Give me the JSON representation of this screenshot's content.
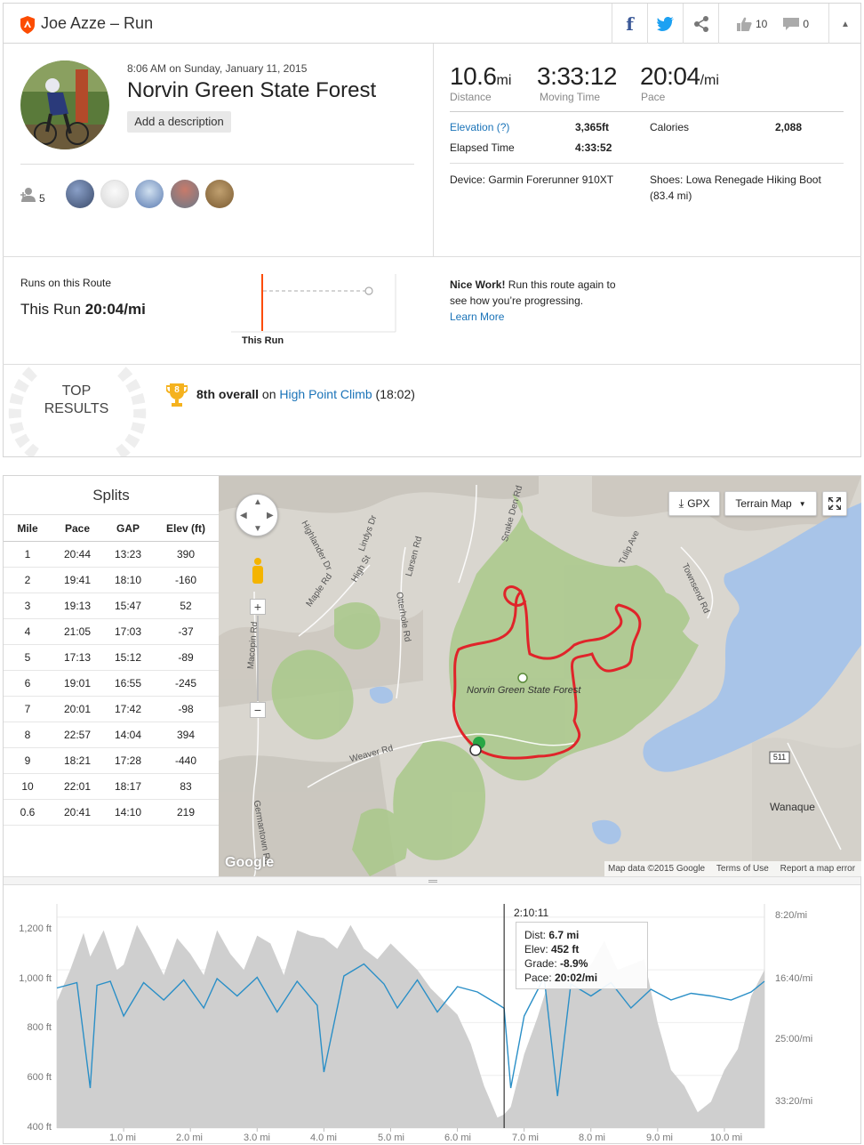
{
  "header": {
    "title": "Joe Azze – Run",
    "kudos_count": "10",
    "comment_count": "0"
  },
  "activity": {
    "datetime": "8:06 AM on Sunday, January 11, 2015",
    "name": "Norvin Green State Forest",
    "add_description": "Add a description",
    "athlete_count": "5"
  },
  "stats": {
    "distance_value": "10.6",
    "distance_unit": "mi",
    "distance_label": "Distance",
    "moving_time_value": "3:33:12",
    "moving_time_label": "Moving Time",
    "pace_value": "20:04",
    "pace_unit": "/mi",
    "pace_label": "Pace",
    "elevation_label": "Elevation (?)",
    "elevation_value": "3,365ft",
    "calories_label": "Calories",
    "calories_value": "2,088",
    "elapsed_label": "Elapsed Time",
    "elapsed_value": "4:33:52",
    "device": "Device: Garmin Forerunner 910XT",
    "shoes_line1": "Shoes: Lowa Renegade Hiking Boot",
    "shoes_line2": "(83.4 mi)"
  },
  "route": {
    "heading": "Runs on this Route",
    "this_run_prefix": "This Run",
    "this_run_value": "20:04/mi",
    "bar_label": "This Run",
    "nice_work_bold": "Nice Work!",
    "nice_work_text1": " Run this route again to",
    "nice_work_text2": "see how you’re progressing.",
    "learn_more": "Learn More"
  },
  "top_results": {
    "line1": "TOP",
    "line2": "RESULTS",
    "medal": "8",
    "rank": "8th overall",
    "on": " on ",
    "segment": "High Point Climb",
    "time": " (18:02)"
  },
  "splits": {
    "title": "Splits",
    "columns": [
      "Mile",
      "Pace",
      "GAP",
      "Elev (ft)"
    ],
    "rows": [
      [
        "1",
        "20:44",
        "13:23",
        "390"
      ],
      [
        "2",
        "19:41",
        "18:10",
        "-160"
      ],
      [
        "3",
        "19:13",
        "15:47",
        "52"
      ],
      [
        "4",
        "21:05",
        "17:03",
        "-37"
      ],
      [
        "5",
        "17:13",
        "15:12",
        "-89"
      ],
      [
        "6",
        "19:01",
        "16:55",
        "-245"
      ],
      [
        "7",
        "20:01",
        "17:42",
        "-98"
      ],
      [
        "8",
        "22:57",
        "14:04",
        "394"
      ],
      [
        "9",
        "18:21",
        "17:28",
        "-440"
      ],
      [
        "10",
        "22:01",
        "18:17",
        "83"
      ],
      [
        "0.6",
        "20:41",
        "14:10",
        "219"
      ]
    ]
  },
  "map": {
    "gpx_label": "GPX",
    "terrain_label": "Terrain Map",
    "forest_label": "Norvin Green State Forest",
    "town_label": "Wanaque",
    "route_number": "511",
    "attribution": "Map data ©2015 Google",
    "terms": "Terms of Use",
    "report": "Report a map error",
    "google": "Google",
    "road_labels": [
      "Maple Rd",
      "High St",
      "Otterhole Rd",
      "Macopin Rd",
      "Weaver Rd",
      "Germantown Rd",
      "Townsend Rd",
      "Snake Den Rd",
      "Larsen Rd",
      "Tulip Ave",
      "Highlander Dr",
      "Lindys Dr"
    ]
  },
  "chart_data": {
    "type": "area",
    "x_unit": "mi",
    "xlim": [
      0,
      10.6
    ],
    "x_ticks": [
      "1.0 mi",
      "2.0 mi",
      "3.0 mi",
      "4.0 mi",
      "5.0 mi",
      "6.0 mi",
      "7.0 mi",
      "8.0 mi",
      "9.0 mi",
      "10.0 mi"
    ],
    "y_left_ticks": [
      "1,200 ft",
      "1,000 ft",
      "800 ft",
      "600 ft",
      "400 ft"
    ],
    "y_right_ticks": [
      "8:20/mi",
      "16:40/mi",
      "25:00/mi",
      "33:20/mi"
    ],
    "ylim_elevation_ft": [
      400,
      1250
    ],
    "series": [
      {
        "name": "Elev",
        "x": [
          0,
          0.2,
          0.4,
          0.5,
          0.7,
          0.9,
          1.0,
          1.2,
          1.4,
          1.6,
          1.8,
          2.0,
          2.2,
          2.4,
          2.6,
          2.8,
          3.0,
          3.2,
          3.4,
          3.6,
          3.8,
          4.0,
          4.2,
          4.4,
          4.6,
          4.8,
          5.0,
          5.2,
          5.4,
          5.6,
          5.8,
          6.0,
          6.2,
          6.4,
          6.6,
          6.7,
          6.8,
          7.0,
          7.2,
          7.4,
          7.6,
          7.8,
          8.0,
          8.2,
          8.4,
          8.6,
          8.8,
          9.0,
          9.2,
          9.4,
          9.6,
          9.8,
          10.0,
          10.2,
          10.4,
          10.6
        ],
        "values": [
          880,
          1000,
          1140,
          1050,
          1150,
          1000,
          1020,
          1170,
          1080,
          980,
          1120,
          1060,
          980,
          1150,
          1060,
          1000,
          1130,
          1100,
          980,
          1150,
          1130,
          1120,
          1080,
          1170,
          1080,
          1040,
          1100,
          1050,
          1000,
          930,
          880,
          830,
          720,
          560,
          440,
          452,
          480,
          680,
          820,
          980,
          1050,
          980,
          1020,
          1110,
          1000,
          1020,
          1040,
          800,
          620,
          560,
          460,
          500,
          620,
          700,
          900,
          1000
        ]
      },
      {
        "name": "Pace",
        "x": [
          0,
          0.3,
          0.5,
          0.6,
          0.8,
          1.0,
          1.3,
          1.6,
          1.9,
          2.2,
          2.4,
          2.7,
          3.0,
          3.3,
          3.6,
          3.9,
          4.0,
          4.3,
          4.6,
          4.9,
          5.1,
          5.4,
          5.7,
          6.0,
          6.3,
          6.6,
          6.7,
          6.8,
          7.0,
          7.3,
          7.5,
          7.7,
          8.0,
          8.3,
          8.6,
          8.9,
          9.2,
          9.5,
          9.8,
          10.1,
          10.4,
          10.6
        ],
        "values": [
          "17:30",
          "16:50",
          "30:00",
          "17:10",
          "16:40",
          "21:00",
          "16:50",
          "19:00",
          "16:30",
          "20:00",
          "16:20",
          "18:30",
          "16:10",
          "20:30",
          "16:40",
          "19:40",
          "28:00",
          "16:00",
          "14:30",
          "17:00",
          "20:00",
          "16:30",
          "20:30",
          "17:20",
          "18:00",
          "19:30",
          "20:02",
          "30:00",
          "21:00",
          "16:10",
          "31:00",
          "17:00",
          "18:30",
          "16:50",
          "20:00",
          "17:40",
          "19:00",
          "18:10",
          "18:30",
          "19:00",
          "18:00",
          "16:40"
        ]
      }
    ],
    "tooltip": {
      "time": "2:10:11",
      "dist_label": "Dist:",
      "dist_value": "6.7 mi",
      "elev_label": "Elev:",
      "elev_value": "452 ft",
      "grade_label": "Grade:",
      "grade_value": "-8.9%",
      "pace_label": "Pace:",
      "pace_value": "20:02/mi"
    }
  },
  "colors": {
    "accent_orange": "#fc4c02",
    "link_blue": "#1a73b8",
    "route_red": "#e0242a",
    "pace_line": "#2a8fc7",
    "elev_fill": "#cfcfcf",
    "twitter": "#1da1f2",
    "facebook": "#3b5998"
  }
}
